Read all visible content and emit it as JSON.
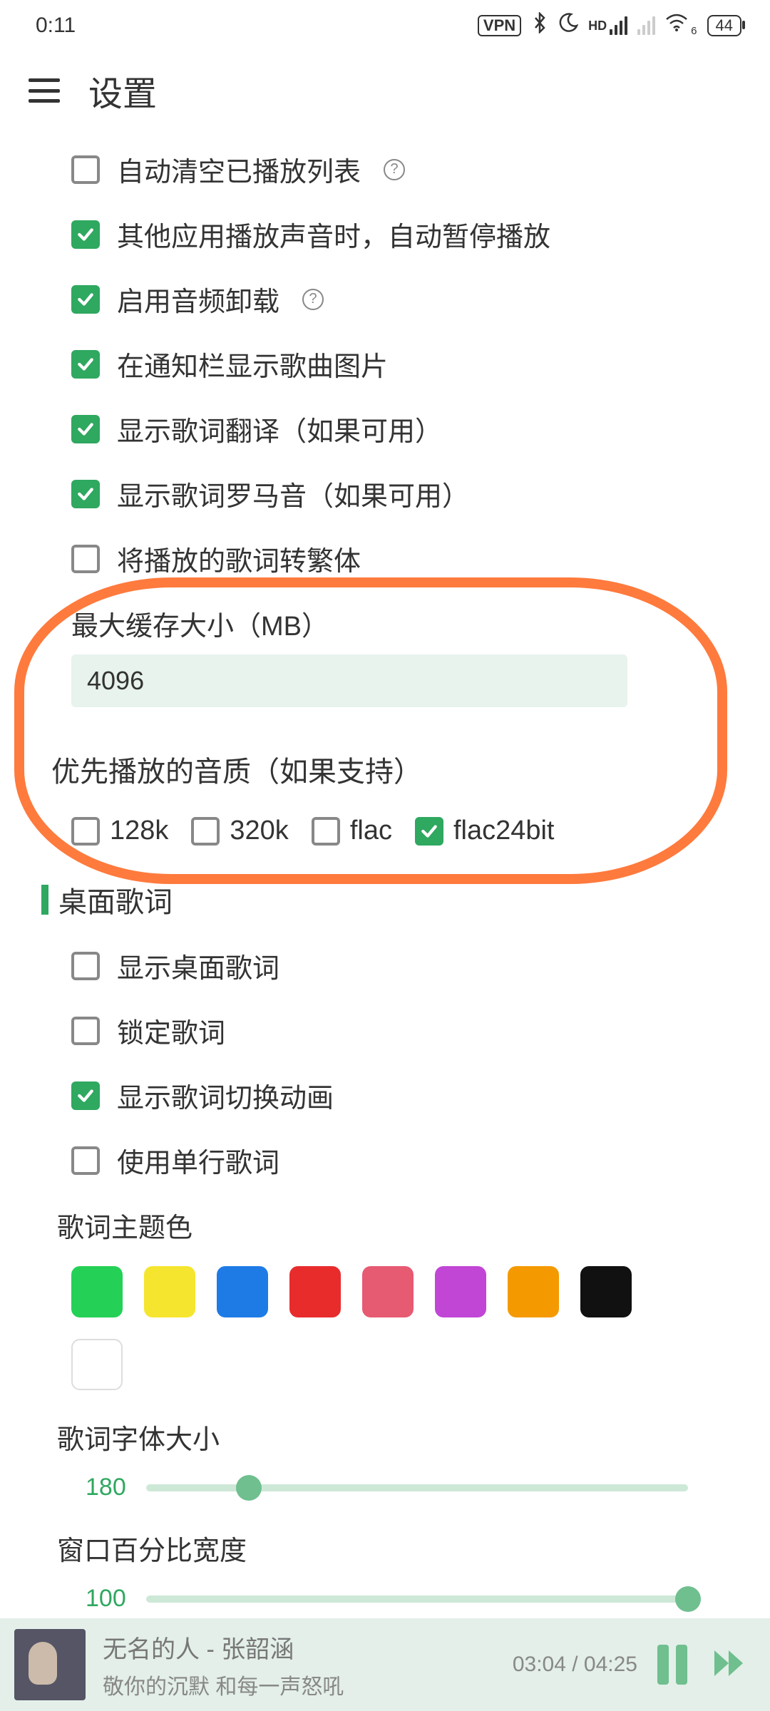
{
  "status": {
    "time": "0:11",
    "vpn": "VPN",
    "battery": "44",
    "hd": "HD",
    "wifi_sub": "6"
  },
  "header": {
    "title": "设置"
  },
  "settings": {
    "rows": [
      {
        "label": "自动清空已播放列表",
        "checked": false,
        "help": true
      },
      {
        "label": "其他应用播放声音时，自动暂停播放",
        "checked": true,
        "help": false
      },
      {
        "label": "启用音频卸载",
        "checked": true,
        "help": true
      },
      {
        "label": "在通知栏显示歌曲图片",
        "checked": true,
        "help": false
      },
      {
        "label": "显示歌词翻译（如果可用）",
        "checked": true,
        "help": false
      },
      {
        "label": "显示歌词罗马音（如果可用）",
        "checked": true,
        "help": false
      },
      {
        "label": "将播放的歌词转繁体",
        "checked": false,
        "help": false
      }
    ],
    "cache_label": "最大缓存大小（MB）",
    "cache_value": "4096"
  },
  "quality": {
    "section_title": "优先播放的音质（如果支持）",
    "options": [
      {
        "label": "128k",
        "checked": false
      },
      {
        "label": "320k",
        "checked": false
      },
      {
        "label": "flac",
        "checked": false
      },
      {
        "label": "flac24bit",
        "checked": true
      }
    ]
  },
  "desktop_lyrics": {
    "section_title": "桌面歌词",
    "rows": [
      {
        "label": "显示桌面歌词",
        "checked": false
      },
      {
        "label": "锁定歌词",
        "checked": false
      },
      {
        "label": "显示歌词切换动画",
        "checked": true
      },
      {
        "label": "使用单行歌词",
        "checked": false
      }
    ],
    "theme_label": "歌词主题色",
    "colors": [
      "#24d156",
      "#f6e52e",
      "#1e7be6",
      "#e82c2c",
      "#e65a72",
      "#c146d6",
      "#f49a00",
      "#111111",
      "#ffffff"
    ],
    "font_size_label": "歌词字体大小",
    "font_size_value": "180",
    "font_size_fill": 19,
    "window_width_label": "窗口百分比宽度",
    "window_width_value": "100",
    "window_width_fill": 100
  },
  "player": {
    "title": "无名的人 - 张韶涵",
    "subtitle": "敬你的沉默 和每一声怒吼",
    "current": "03:04",
    "total": "04:25"
  }
}
